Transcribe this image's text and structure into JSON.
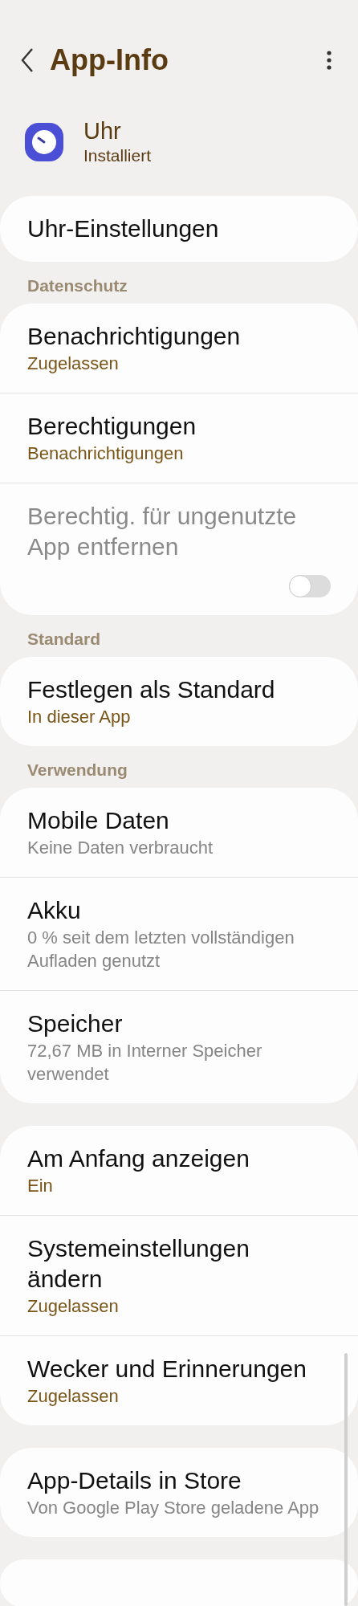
{
  "header": {
    "title": "App-Info"
  },
  "app": {
    "name": "Uhr",
    "status": "Installiert"
  },
  "sections": [
    {
      "items": [
        {
          "title": "Uhr-Einstellungen",
          "kind": "plain",
          "disabled": false
        }
      ]
    },
    {
      "label": "Datenschutz",
      "items": [
        {
          "title": "Benachrichtigungen",
          "subtitle": "Zugelassen",
          "kind": "status",
          "disabled": false
        },
        {
          "title": "Berechtigungen",
          "subtitle": "Benachrichtigungen",
          "kind": "status",
          "disabled": false
        },
        {
          "title": "Berechtig. für ungenutzte App entfernen",
          "kind": "toggle",
          "on": false,
          "disabled": true
        }
      ]
    },
    {
      "label": "Standard",
      "items": [
        {
          "title": "Festlegen als Standard",
          "subtitle": "In dieser App",
          "kind": "status",
          "disabled": false
        }
      ]
    },
    {
      "label": "Verwendung",
      "items": [
        {
          "title": "Mobile Daten",
          "subtitle": "Keine Daten verbraucht",
          "kind": "info",
          "disabled": false
        },
        {
          "title": "Akku",
          "subtitle": "0 % seit dem letzten vollständigen Aufladen genutzt",
          "kind": "info",
          "disabled": false
        },
        {
          "title": "Speicher",
          "subtitle": "72,67 MB in Interner Speicher verwendet",
          "kind": "info",
          "disabled": false
        }
      ]
    },
    {
      "items": [
        {
          "title": "Am Anfang anzeigen",
          "subtitle": "Ein",
          "kind": "status",
          "disabled": false
        },
        {
          "title": "Systemeinstellungen ändern",
          "subtitle": "Zugelassen",
          "kind": "status",
          "disabled": false
        },
        {
          "title": "Wecker und Erinnerungen",
          "subtitle": "Zugelassen",
          "kind": "status",
          "disabled": false
        }
      ]
    },
    {
      "items": [
        {
          "title": "App-Details in Store",
          "subtitle": "Von Google Play Store geladene App",
          "kind": "info",
          "disabled": false
        }
      ]
    },
    {
      "kind": "blank"
    }
  ]
}
